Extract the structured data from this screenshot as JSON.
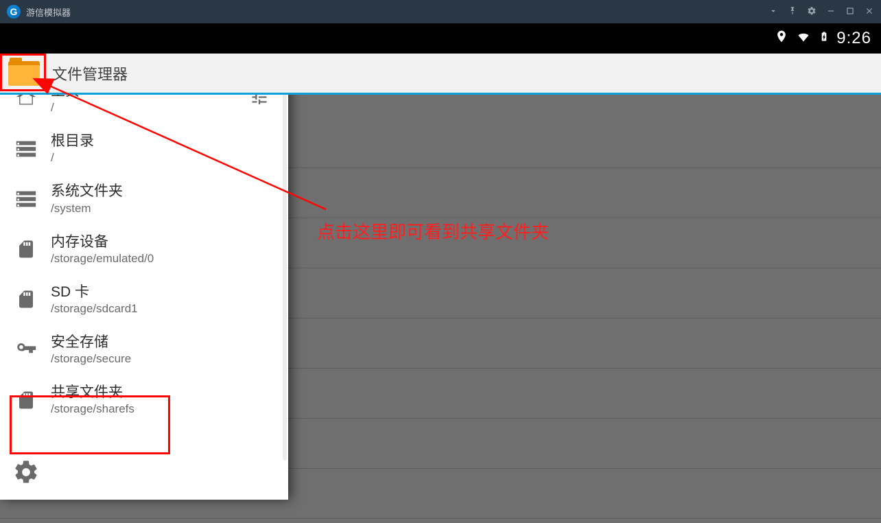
{
  "emulator": {
    "title": "游信模拟器"
  },
  "statusbar": {
    "time": "9:26"
  },
  "app": {
    "title": "文件管理器"
  },
  "drawer": {
    "items": [
      {
        "title": "主页",
        "path": "/"
      },
      {
        "title": "根目录",
        "path": "/"
      },
      {
        "title": "系统文件夹",
        "path": "/system"
      },
      {
        "title": "内存设备",
        "path": "/storage/emulated/0"
      },
      {
        "title": "SD 卡",
        "path": "/storage/sdcard1"
      },
      {
        "title": "安全存储",
        "path": "/storage/secure"
      },
      {
        "title": "共享文件夹",
        "path": "/storage/sharefs"
      }
    ]
  },
  "annotation": {
    "text": "点击这里即可看到共享文件夹"
  }
}
